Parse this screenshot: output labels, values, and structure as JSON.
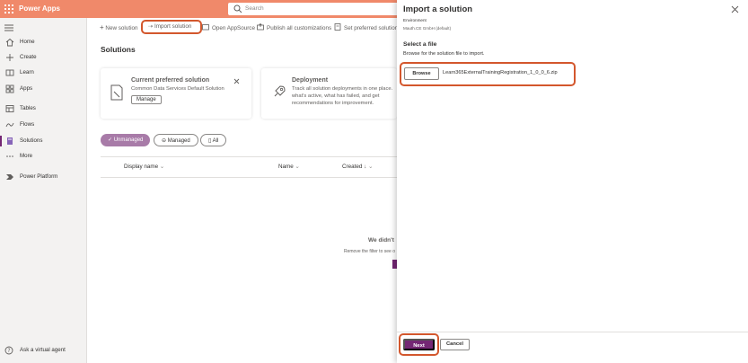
{
  "app": {
    "title": "Power Apps"
  },
  "search": {
    "placeholder": "Search"
  },
  "sidebar": {
    "items": [
      {
        "label": "Home",
        "icon": "home-icon"
      },
      {
        "label": "Create",
        "icon": "plus-icon"
      },
      {
        "label": "Learn",
        "icon": "book-icon"
      },
      {
        "label": "Apps",
        "icon": "apps-icon"
      },
      {
        "label": "Tables",
        "icon": "table-icon"
      },
      {
        "label": "Flows",
        "icon": "flow-icon"
      },
      {
        "label": "Solutions",
        "icon": "solutions-icon",
        "active": true
      },
      {
        "label": "More",
        "icon": "ellipsis-icon"
      },
      {
        "label": "Power Platform",
        "icon": "power-platform-icon"
      }
    ],
    "ask_agent": "Ask a virtual agent"
  },
  "toolbar": {
    "new_solution": "New solution",
    "import_solution": "Import solution",
    "open_appsource": "Open AppSource",
    "publish_all": "Publish all customizations",
    "set_preferred": "Set preferred solution"
  },
  "page": {
    "title": "Solutions"
  },
  "cards": {
    "preferred": {
      "title": "Current preferred solution",
      "subtitle": "Common Data Services Default Solution",
      "button": "Manage"
    },
    "deployment": {
      "title": "Deployment",
      "lines": [
        "Track all solution deployments in one place.",
        "what's active, what has failed, and get",
        "recommendations for improvement."
      ]
    }
  },
  "filters": {
    "unmanaged": "Unmanaged",
    "managed": "Managed",
    "all": "All"
  },
  "table": {
    "columns": [
      "Display name",
      "Name",
      "Created"
    ]
  },
  "empty": {
    "title": "We didn't",
    "subtitle": "Remove the filter to see o"
  },
  "panel": {
    "title": "Import a solution",
    "env_label": "Environment",
    "env_value": "Mauth.CE GmbH (default)",
    "section_title": "Select a file",
    "section_desc": "Browse for the solution file to import.",
    "browse": "Browse",
    "file_name": "Learn365ExternalTrainingRegistration_1_0_0_6.zip",
    "next": "Next",
    "cancel": "Cancel"
  },
  "colors": {
    "accent": "#742774",
    "highlight": "#d3572d",
    "topbar": "#f0896a"
  }
}
